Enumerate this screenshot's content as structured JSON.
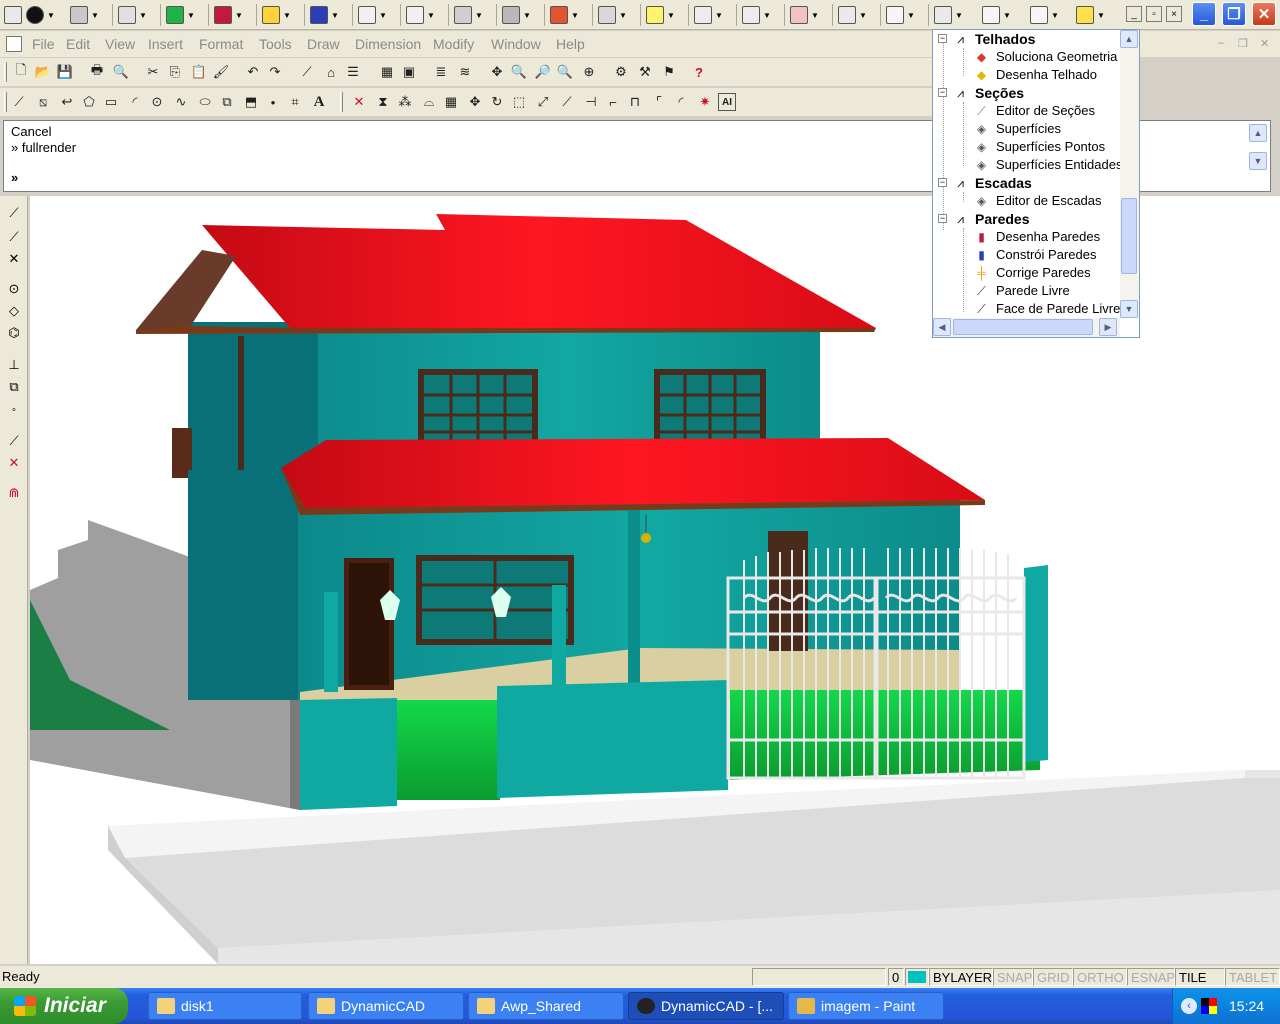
{
  "app": {
    "title": "DynamicCAD",
    "colors": {
      "accent_blue": "#245edb",
      "roof_red": "#e00f1a",
      "wall_teal": "#10908c",
      "grass_green": "#0fc640"
    }
  },
  "top_toolbar": {
    "dropdowns": [
      "snap",
      "orbit",
      "layer",
      "render",
      "geometry",
      "solid",
      "wall",
      "grid",
      "edit",
      "shape",
      "surface",
      "roof",
      "cut",
      "ruler",
      "undo",
      "view",
      "measure",
      "section",
      "3d-box",
      "dim",
      "tree",
      "window"
    ]
  },
  "menubar": {
    "items": [
      "File",
      "Edit",
      "View",
      "Insert",
      "Format",
      "Tools",
      "Draw",
      "Dimension",
      "Modify",
      "Window",
      "Help"
    ]
  },
  "command": {
    "lines": [
      "Cancel",
      "» fullrender",
      "»"
    ]
  },
  "tree": {
    "items": [
      {
        "type": "category",
        "label": "Telhados"
      },
      {
        "type": "leaf",
        "label": "Soluciona Geometria"
      },
      {
        "type": "leaf",
        "label": "Desenha Telhado"
      },
      {
        "type": "category",
        "label": "Seções"
      },
      {
        "type": "leaf",
        "label": "Editor de Seções"
      },
      {
        "type": "leaf",
        "label": "Superfícies"
      },
      {
        "type": "leaf",
        "label": "Superfícies Pontos"
      },
      {
        "type": "leaf",
        "label": "Superfícies Entidades"
      },
      {
        "type": "category",
        "label": "Escadas"
      },
      {
        "type": "leaf",
        "label": "Editor de Escadas"
      },
      {
        "type": "category",
        "label": "Paredes"
      },
      {
        "type": "leaf",
        "label": "Desenha Paredes"
      },
      {
        "type": "leaf",
        "label": "Constrói Paredes"
      },
      {
        "type": "leaf",
        "label": "Corrige Paredes"
      },
      {
        "type": "leaf",
        "label": "Parede Livre"
      },
      {
        "type": "leaf",
        "label": "Face de Parede Livre"
      }
    ]
  },
  "status": {
    "text": "Ready",
    "layer": "0",
    "color": "BYLAYER",
    "swatch": "#00c0c0",
    "toggles": [
      {
        "label": "SNAP",
        "on": false
      },
      {
        "label": "GRID",
        "on": false
      },
      {
        "label": "ORTHO",
        "on": false
      },
      {
        "label": "ESNAP",
        "on": false
      },
      {
        "label": "TILE",
        "on": true
      },
      {
        "label": "TABLET",
        "on": false
      }
    ]
  },
  "taskbar": {
    "start_label": "Iniciar",
    "tasks": [
      "disk1",
      "DynamicCAD",
      "Awp_Shared",
      "DynamicCAD - [...",
      "imagem - Paint"
    ],
    "clock": "15:24"
  }
}
